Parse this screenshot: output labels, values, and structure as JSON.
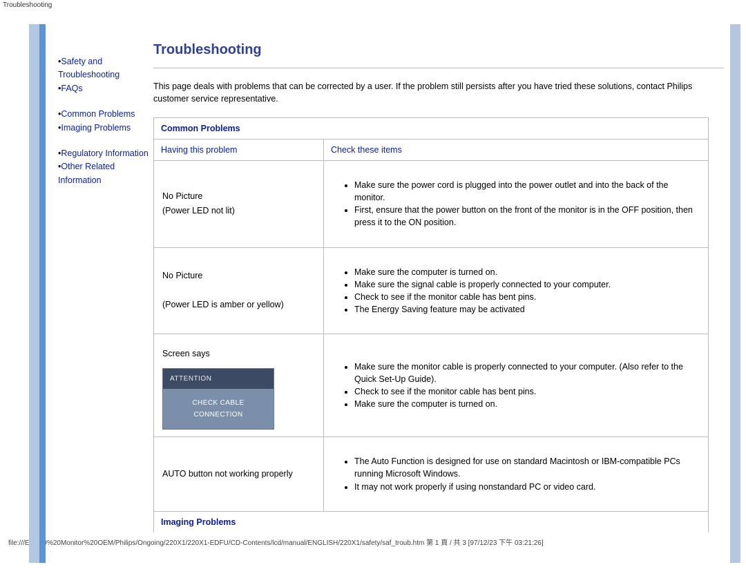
{
  "topLabel": "Troubleshooting",
  "nav": {
    "items": [
      {
        "label": "Safety and Troubleshooting"
      },
      {
        "label": "FAQs"
      },
      {
        "label": "Common Problems"
      },
      {
        "label": "Imaging Problems"
      },
      {
        "label": "Regulatory Information"
      },
      {
        "label": "Other Related Information"
      }
    ]
  },
  "title": "Troubleshooting",
  "intro": "This page deals with problems that can be corrected by a user. If the problem still persists after you have tried these solutions, contact Philips customer service representative.",
  "table": {
    "section1": "Common Problems",
    "col1": "Having this problem",
    "col2": "Check these items",
    "rows": [
      {
        "left1": "No Picture",
        "left2": "(Power LED not lit)",
        "checks": [
          "Make sure the power cord is plugged into the power outlet and into the back of the monitor.",
          "First, ensure that the power button on the front of the monitor is in the OFF position, then press it to the ON position."
        ]
      },
      {
        "left1": "No Picture",
        "left2": "(Power LED is amber or yellow)",
        "checks": [
          "Make sure the computer is turned on.",
          "Make sure the signal cable is properly connected to your computer.",
          "Check to see if the monitor cable has bent pins.",
          "The Energy Saving feature may be activated"
        ]
      },
      {
        "left1": "Screen says",
        "attentionHead": "ATTENTION",
        "attentionBody": "CHECK CABLE CONNECTION",
        "checks": [
          "Make sure the monitor cable is properly connected to your computer. (Also refer to the Quick Set-Up Guide).",
          "Check to see if the monitor cable has bent pins.",
          "Make sure the computer is turned on."
        ]
      },
      {
        "left1": "AUTO button not working properly",
        "checks": [
          "The Auto Function is designed for use on standard Macintosh or IBM-compatible PCs running Microsoft Windows.",
          "It may not work properly if using nonstandard PC or video card."
        ]
      }
    ],
    "section2": "Imaging Problems"
  },
  "footer": "file:///E|/LCD%20Monitor%20OEM/Philips/Ongoing/220X1/220X1-EDFU/CD-Contents/lcd/manual/ENGLISH/220X1/safety/saf_troub.htm 第 1 頁 / 共 3  [97/12/23 下午 03:21:26]"
}
